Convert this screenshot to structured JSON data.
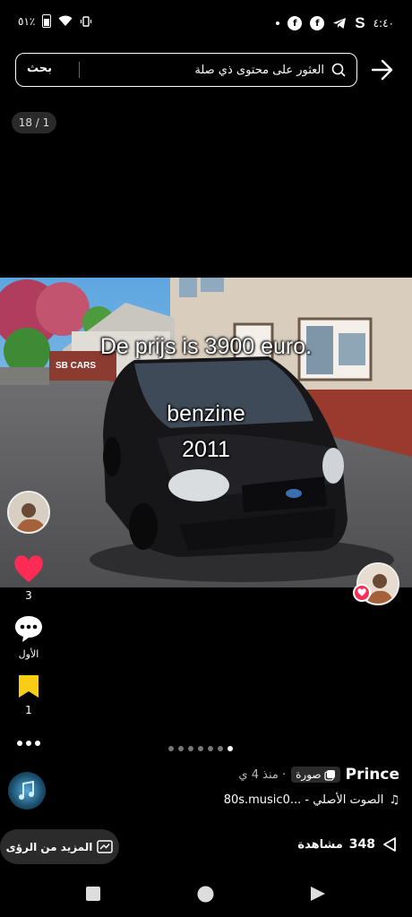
{
  "status_bar": {
    "battery_text": "٥١٪",
    "time": "٤:٤٠",
    "icons": [
      "battery-icon",
      "wifi-icon",
      "vibrate-icon",
      "dot-icon",
      "facebook-icon",
      "facebook-icon",
      "telegram-icon",
      "s-app-icon"
    ]
  },
  "search": {
    "placeholder": "العثور على محتوى ذي صلة",
    "button_label": "بحث"
  },
  "page_counter": "18 / 1",
  "photo": {
    "line1": "De prijs is 3900 euro.",
    "line2": "benzine",
    "line3": "2011",
    "sign_text": "SB CARS"
  },
  "actions": {
    "likes_count": "3",
    "comments_label": "الأول",
    "saves_count": "1"
  },
  "carousel": {
    "count": 7,
    "active_index": 6
  },
  "post": {
    "author": "Prince",
    "type_label": "صورة",
    "time_ago": "منذ 4 ي",
    "music_text": "الصوت الأصلي - ...80s.music0"
  },
  "insights_label": "المزيد من الرؤى",
  "views_count": "348",
  "views_label": "مشاهدة",
  "colors": {
    "like": "#fe2c55",
    "save": "#facd15",
    "background": "#000000"
  }
}
